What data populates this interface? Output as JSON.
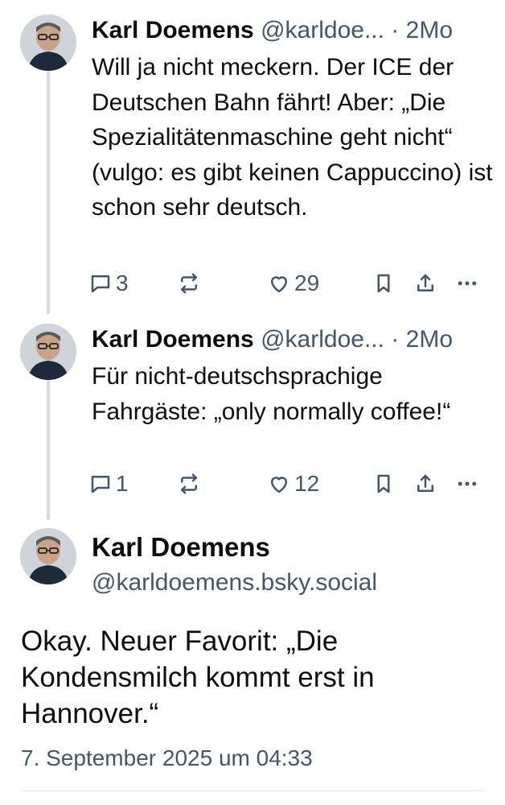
{
  "posts": [
    {
      "author_name": "Karl Doemens",
      "handle": "@karldoe...",
      "separator": "·",
      "time": "2Mo",
      "text": "Will ja nicht meckern. Der ICE der Deutschen Bahn fährt! Aber: „Die Spezialitätenmaschine geht nicht“ (vulgo: es gibt keinen Cappuccino) ist schon sehr deutsch.",
      "reply_count": "3",
      "repost_count": "",
      "like_count": "29"
    },
    {
      "author_name": "Karl Doemens",
      "handle": "@karldoe...",
      "separator": "·",
      "time": "2Mo",
      "text": "Für nicht-deutschsprachige Fahrgäste: „only normally coffee!“",
      "reply_count": "1",
      "repost_count": "",
      "like_count": "12"
    }
  ],
  "main_post": {
    "author_name": "Karl Doemens",
    "handle": "@karldoemens.bsky.social",
    "text": "Okay. Neuer Favorit: „Die Kondensmilch kommt erst in Hannover.“",
    "timestamp": "7. September 2025 um 04:33"
  },
  "icons": [
    "avatar-photo",
    "reply-icon",
    "repost-icon",
    "like-heart-icon",
    "bookmark-icon",
    "share-icon",
    "more-icon"
  ],
  "colors": {
    "text": "#0b0f14",
    "muted": "#42576c",
    "thread_line": "#d4dbe2",
    "divider": "#e0e6ec"
  }
}
